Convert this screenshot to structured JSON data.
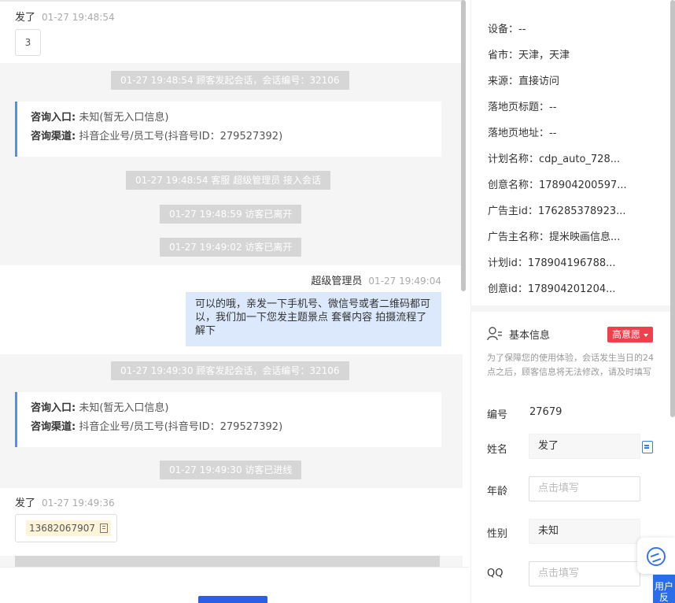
{
  "chat": {
    "msg1": {
      "sender": "发了",
      "time": "01-27 19:48:54",
      "text": "3"
    },
    "sys1": "01-27 19:48:54 顾客发起会话，会话编号：32106",
    "card1": {
      "entry_label": "咨询入口:",
      "entry_value": "未知(暂无入口信息)",
      "channel_label": "咨询渠道:",
      "channel_value": "抖音企业号/员工号(抖音号ID：279527392)"
    },
    "sys2": "01-27 19:48:54 客服 超级管理员 接入会话",
    "sys3": "01-27 19:48:59 访客已离开",
    "sys4": "01-27 19:49:02 访客已离开",
    "agent_msg": {
      "sender": "超级管理员",
      "time": "01-27 19:49:04",
      "text": "可以的哦，亲发一下手机号、微信号或者二维码都可以，我们加一下您发主题景点 套餐内容 拍摄流程了解下"
    },
    "sys5": "01-27 19:49:30 顾客发起会话，会话编号：32106",
    "card2": {
      "entry_label": "咨询入口:",
      "entry_value": "未知(暂无入口信息)",
      "channel_label": "咨询渠道:",
      "channel_value": "抖音企业号/员工号(抖音号ID：279527392)"
    },
    "sys6": "01-27 19:49:30 访客已进线",
    "msg2": {
      "sender": "发了",
      "time": "01-27 19:49:36",
      "phone": "13682067907"
    }
  },
  "visitor_info": {
    "device": "设备：--",
    "province": "省市：天津，天津",
    "source": "来源：直接访问",
    "landing_title": "落地页标题：--",
    "landing_url": "落地页地址：--",
    "plan_name": "计划名称：cdp_auto_728...",
    "creative_name": "创意名称：178904200597...",
    "advertiser_id": "广告主id：176285378923...",
    "advertiser_name": "广告主名称：提米映画信息...",
    "plan_id": "计划id：178904196788...",
    "creative_id": "创意id：178904201204..."
  },
  "basic_info": {
    "title": "基本信息",
    "intent": "高意愿",
    "notice": "为了保障您的使用体验，会话发生当日的24点之后，顾客信息将无法修改，请及时填写",
    "id_label": "编号",
    "id_value": "27679",
    "name_label": "姓名",
    "name_value": "发了",
    "age_label": "年龄",
    "age_placeholder": "点击填写",
    "gender_label": "性别",
    "gender_value": "未知",
    "qq_label": "QQ",
    "qq_placeholder": "点击填写"
  },
  "float": {
    "feedback": "用户反"
  },
  "icons": {
    "copy": "copy-icon",
    "user": "user-list-icon",
    "logo": "service-logo-icon"
  },
  "colors": {
    "accent": "#2b6de8",
    "intent": "#f0404b",
    "agent_bubble": "#dce8fb",
    "card_border": "#5b8fd9"
  }
}
